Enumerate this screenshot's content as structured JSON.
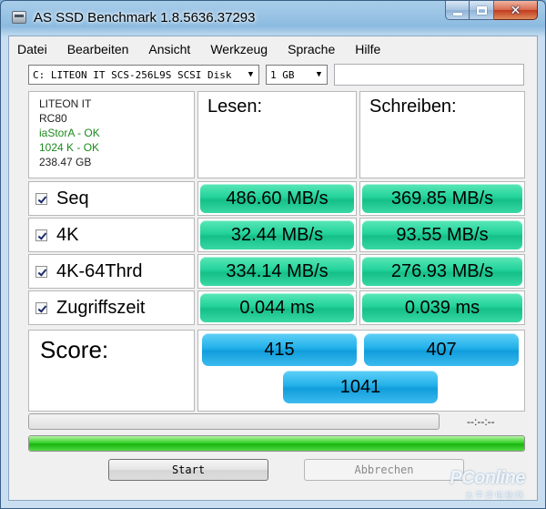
{
  "window": {
    "title": "AS SSD Benchmark 1.8.5636.37293"
  },
  "menu": [
    "Datei",
    "Bearbeiten",
    "Ansicht",
    "Werkzeug",
    "Sprache",
    "Hilfe"
  ],
  "toolbar": {
    "drive": "C: LITEON IT SCS-256L9S SCSI Disk",
    "size": "1 GB"
  },
  "drive_info": {
    "vendor": "LITEON IT",
    "firmware": "RC80",
    "driver": "iaStorA - OK",
    "alignment": "1024 K - OK",
    "capacity": "238.47 GB"
  },
  "columns": {
    "read": "Lesen:",
    "write": "Schreiben:"
  },
  "rows": [
    {
      "label": "Seq",
      "checked": true,
      "read": "486.60 MB/s",
      "write": "369.85 MB/s"
    },
    {
      "label": "4K",
      "checked": true,
      "read": "32.44 MB/s",
      "write": "93.55 MB/s"
    },
    {
      "label": "4K-64Thrd",
      "checked": true,
      "read": "334.14 MB/s",
      "write": "276.93 MB/s"
    },
    {
      "label": "Zugriffszeit",
      "checked": true,
      "read": "0.044 ms",
      "write": "0.039 ms"
    }
  ],
  "score": {
    "label": "Score:",
    "read": "415",
    "write": "407",
    "total": "1041"
  },
  "status": {
    "time": "--:--:--",
    "overall_progress": 1.0,
    "current_progress": 0.0
  },
  "buttons": {
    "start": "Start",
    "abort": "Abbrechen"
  },
  "colors": {
    "result_pill": "#22d39a",
    "score_pill": "#23b1ea",
    "progress": "#37d12a",
    "ok_text": "#1d8a1d"
  },
  "watermark": {
    "logo": "PConline",
    "sub": "太平洋电脑网"
  }
}
